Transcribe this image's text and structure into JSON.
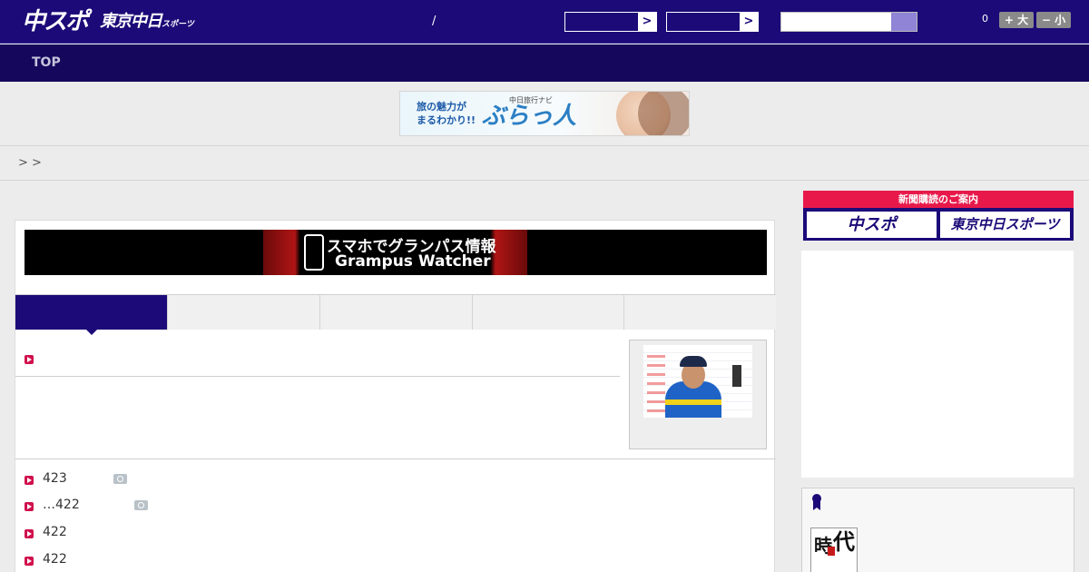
{
  "header": {
    "logo_main": "中スポ",
    "logo_tokyo": "東京中日",
    "logo_tokyo_small": "スポーツ",
    "separator": "/",
    "select_arrow": ">",
    "article_count": "0",
    "font_larger_label": "+ 大",
    "font_smaller_label": "− 小"
  },
  "nav": {
    "top_label": "TOP"
  },
  "ad_banner": {
    "line1": "旅の魅力が",
    "line2": "まるわかり!!",
    "brand_small": "中日旅行ナビ",
    "brand_title": "ぶらっ人"
  },
  "breadcrumb": {
    "text": "> >"
  },
  "grampus_banner": {
    "line1": "スマホでグランパス情報",
    "line2": "Grampus Watcher"
  },
  "news_list": [
    {
      "text": "423",
      "has_photo": true
    },
    {
      "text": "…422",
      "has_photo": true
    },
    {
      "text": "422",
      "has_photo": false
    },
    {
      "text": "422",
      "has_photo": false
    }
  ],
  "subscription": {
    "header": "新聞購読のご案内",
    "option1": "中スポ",
    "option2": "東京中日スポーツ"
  },
  "side_book": {
    "char1": "時",
    "char2": "代"
  },
  "colors": {
    "brand_navy": "#1b0a78",
    "nav_dark": "#14075c",
    "accent_red": "#e8194a",
    "bullet_red": "#d0104c"
  }
}
